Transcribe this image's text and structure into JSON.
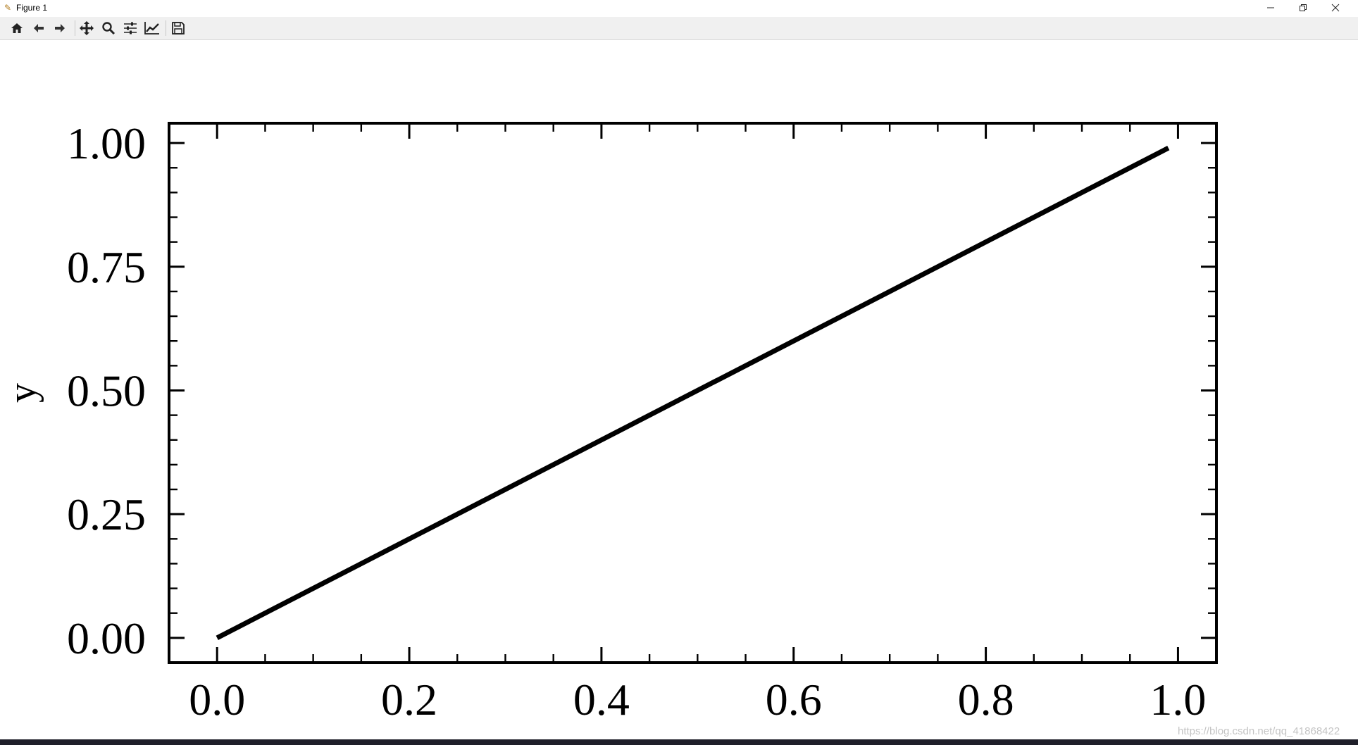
{
  "window": {
    "title": "Figure 1",
    "app_icon": "matplotlib-icon",
    "controls": {
      "minimize": "minimize-icon",
      "restore": "restore-icon",
      "close": "close-icon"
    }
  },
  "toolbar": {
    "buttons": [
      {
        "name": "home",
        "icon": "home-icon"
      },
      {
        "name": "back",
        "icon": "arrow-left-icon"
      },
      {
        "name": "forward",
        "icon": "arrow-right-icon"
      },
      {
        "name": "pan",
        "icon": "move-icon"
      },
      {
        "name": "zoom",
        "icon": "magnifier-icon"
      },
      {
        "name": "configure-subplots",
        "icon": "sliders-icon"
      },
      {
        "name": "edit-axis",
        "icon": "line-chart-icon"
      },
      {
        "name": "save",
        "icon": "floppy-disk-icon"
      }
    ]
  },
  "chart_data": {
    "type": "line",
    "title": "",
    "xlabel": "",
    "ylabel": "y",
    "xlim": [
      -0.05,
      1.04
    ],
    "ylim": [
      -0.05,
      1.04
    ],
    "x_ticks": [
      "0.0",
      "0.2",
      "0.4",
      "0.6",
      "0.8",
      "1.0"
    ],
    "y_ticks": [
      "0.00",
      "0.25",
      "0.50",
      "0.75",
      "1.00"
    ],
    "minor_tick_interval": 0.05,
    "tick_direction": "in",
    "grid": false,
    "legend": "none",
    "line_color": "#000000",
    "series": [
      {
        "x": [
          0.0,
          0.99
        ],
        "y": [
          0.0,
          0.99
        ]
      }
    ]
  },
  "watermark": "https://blog.csdn.net/qq_41868422"
}
